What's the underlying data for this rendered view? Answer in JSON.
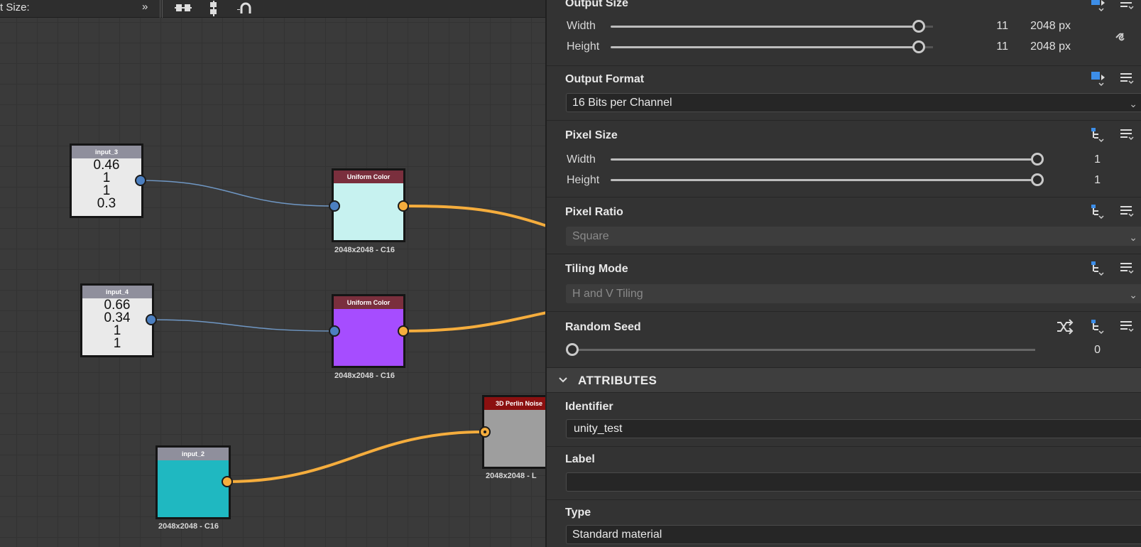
{
  "toolbar": {
    "output_size_label": "t Size:",
    "more_icon": "chevron-double-right-icon"
  },
  "graph": {
    "nodes": {
      "input_3": {
        "title": "input_3",
        "values": [
          "0.46",
          "1",
          "1",
          "0.3"
        ]
      },
      "input_4": {
        "title": "input_4",
        "values": [
          "0.66",
          "0.34",
          "1",
          "1"
        ]
      },
      "input_2": {
        "title": "input_2",
        "caption": "2048x2048 - C16",
        "color": "#1fb8c1"
      },
      "uniform_1": {
        "title": "Uniform Color",
        "caption": "2048x2048 - C16",
        "color": "#c7f2f0",
        "header_color": "#7a2f3d"
      },
      "uniform_2": {
        "title": "Uniform Color",
        "caption": "2048x2048 - C16",
        "color": "#a64dff",
        "header_color": "#7a2f3d"
      },
      "perlin": {
        "title": "3D Perlin Noise",
        "caption": "2048x2048 - L",
        "color": "#9e9e9e",
        "header_color": "#8b1010"
      }
    },
    "wire_colors": {
      "blue": "#6f97c4",
      "orange": "#f5ad3d"
    }
  },
  "panel": {
    "output_size": {
      "title": "Output Size",
      "width_label": "Width",
      "width_value": "11",
      "width_px": "2048 px",
      "height_label": "Height",
      "height_value": "11",
      "height_px": "2048 px"
    },
    "output_format": {
      "title": "Output Format",
      "value": "16 Bits per Channel"
    },
    "pixel_size": {
      "title": "Pixel Size",
      "width_label": "Width",
      "width_value": "1",
      "height_label": "Height",
      "height_value": "1"
    },
    "pixel_ratio": {
      "title": "Pixel Ratio",
      "value": "Square"
    },
    "tiling_mode": {
      "title": "Tiling Mode",
      "value": "H and V Tiling"
    },
    "random_seed": {
      "title": "Random Seed",
      "value": "0"
    },
    "attributes": {
      "header": "ATTRIBUTES",
      "identifier_label": "Identifier",
      "identifier_value": "unity_test",
      "label_label": "Label",
      "label_value": "",
      "type_label": "Type",
      "type_value": "Standard material"
    }
  }
}
